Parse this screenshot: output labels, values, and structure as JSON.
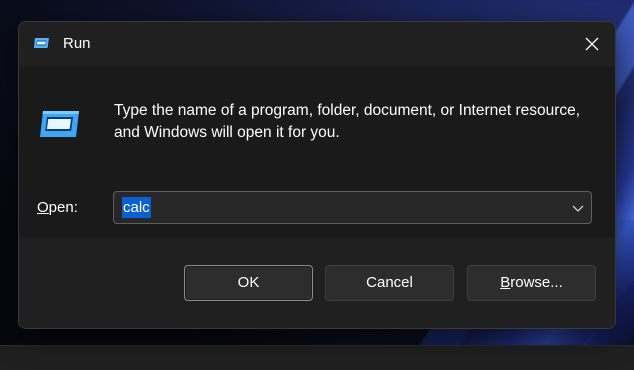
{
  "dialog": {
    "title": "Run",
    "close_icon": "close-icon",
    "app_icon": "run-icon",
    "description": "Type the name of a program, folder, document, or Internet resource, and Windows will open it for you.",
    "open_label_accel": "O",
    "open_label_rest": "pen:",
    "open_value": "calc",
    "dropdown_icon": "chevron-down-icon",
    "buttons": {
      "ok": "OK",
      "cancel": "Cancel",
      "browse_accel": "B",
      "browse_rest": "rowse..."
    }
  },
  "colors": {
    "dialog_bg": "#202020",
    "content_bg": "#1a1a1a",
    "selection": "#0a5fd1",
    "icon_blue": "#4fb3ff"
  }
}
